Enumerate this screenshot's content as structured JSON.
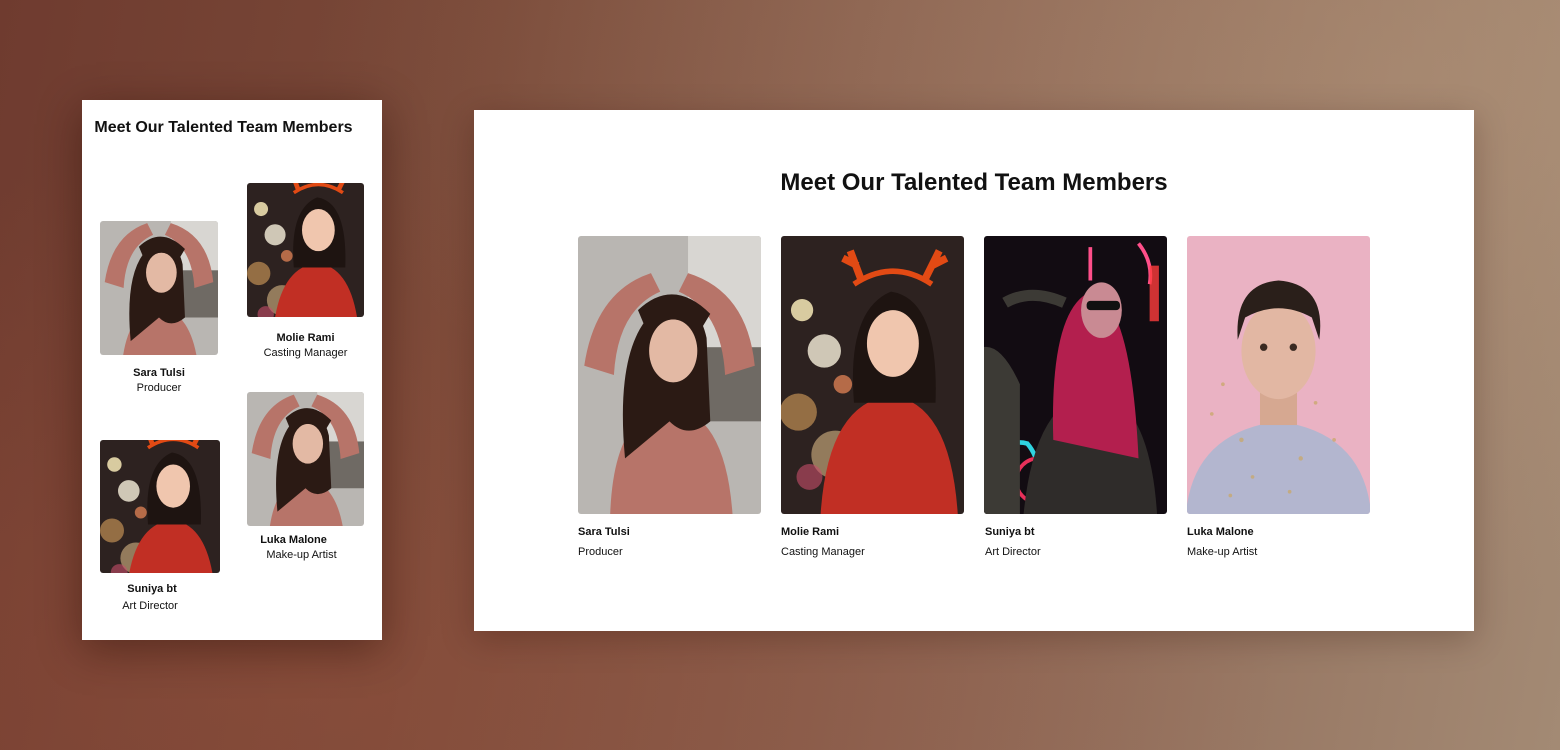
{
  "title": "Meet Our Talented Team Members",
  "members": [
    {
      "name": "Sara Tulsi",
      "role": "Producer",
      "photo_icon": "woman-pink-sweater-photo"
    },
    {
      "name": "Molie Rami",
      "role": "Casting Manager",
      "photo_icon": "woman-reindeer-antlers-photo"
    },
    {
      "name": "Suniya bt",
      "role": "Art Director",
      "photo_icon": "woman-neon-lights-photo"
    },
    {
      "name": "Luka Malone",
      "role": "Make-up Artist",
      "photo_icon": "man-pink-background-photo"
    }
  ]
}
